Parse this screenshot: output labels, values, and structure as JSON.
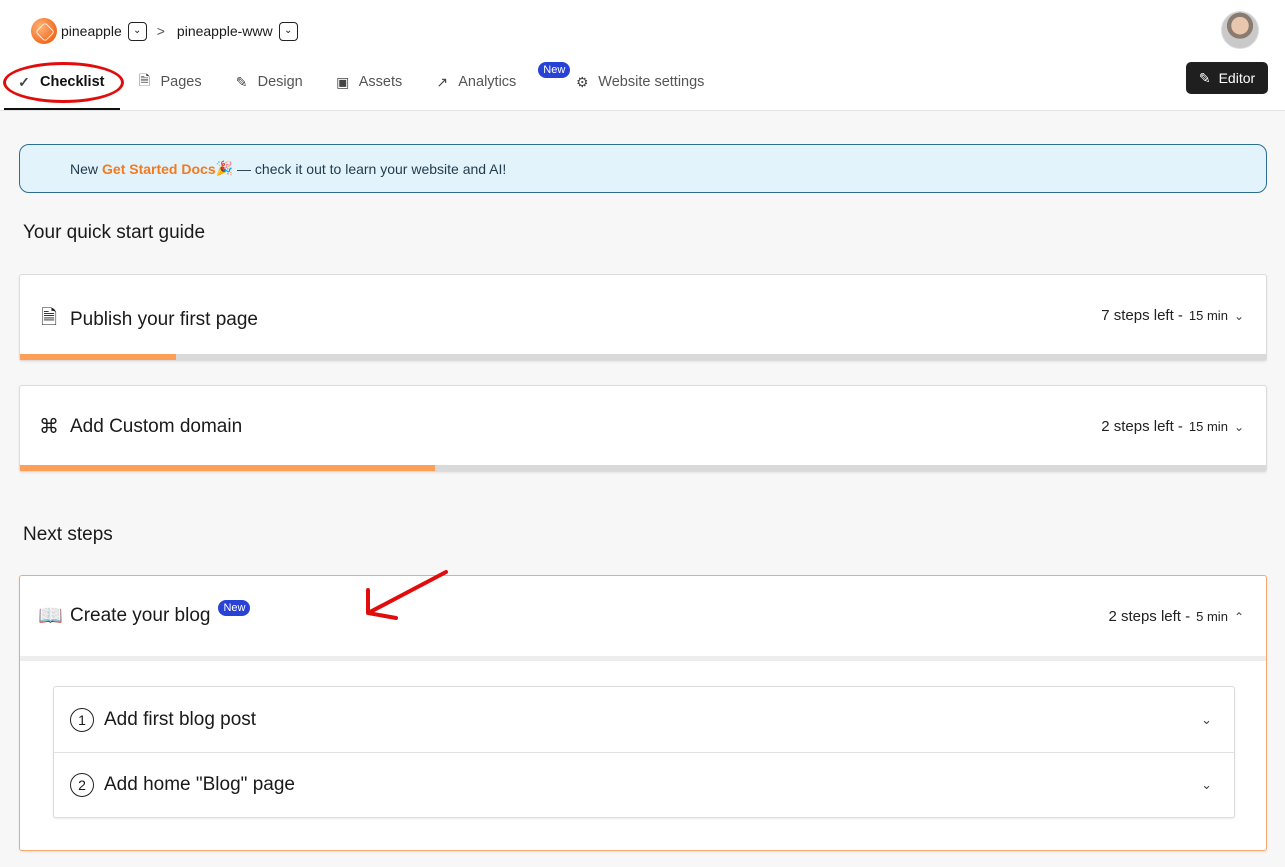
{
  "breadcrumb": {
    "workspace": "pineapple",
    "separator": ">",
    "site": "pineapple-www"
  },
  "tabs": [
    {
      "label": "Checklist",
      "icon": "check-icon",
      "active": true
    },
    {
      "label": "Pages",
      "icon": "file-icon"
    },
    {
      "label": "Design",
      "icon": "pen-tool-icon"
    },
    {
      "label": "Assets",
      "icon": "image-icon"
    },
    {
      "label": "Analytics",
      "icon": "trending-up-icon",
      "badge": "New"
    },
    {
      "label": "Website settings",
      "icon": "gear-icon"
    }
  ],
  "editor_button": "Editor",
  "banner": {
    "prefix": "New",
    "highlight": "Get Started Docs",
    "emoji": "🎉",
    "rest": "— check it out to learn your website and AI!"
  },
  "quick_start": {
    "title": "Your quick start guide",
    "cards": [
      {
        "title": "Publish your first page",
        "icon": "file-text-icon",
        "steps": "7 steps left -",
        "time": "15 min",
        "progress": 0.125
      },
      {
        "title": "Add Custom domain",
        "icon": "command-icon",
        "steps": "2 steps left -",
        "time": "15 min",
        "progress": 0.333
      }
    ]
  },
  "next_steps": {
    "title": "Next steps",
    "blog": {
      "title": "Create your blog",
      "badge": "New",
      "icon": "book-open-icon",
      "steps": "2 steps left -",
      "time": "5 min",
      "substeps": [
        {
          "num": "1",
          "label": "Add first blog post"
        },
        {
          "num": "2",
          "label": "Add home \"Blog\" page"
        }
      ]
    }
  },
  "colors": {
    "accent": "#ff9f57",
    "badge": "#2842d6",
    "banner_bg": "#e3f3fb",
    "annotation": "#e10d0d"
  }
}
